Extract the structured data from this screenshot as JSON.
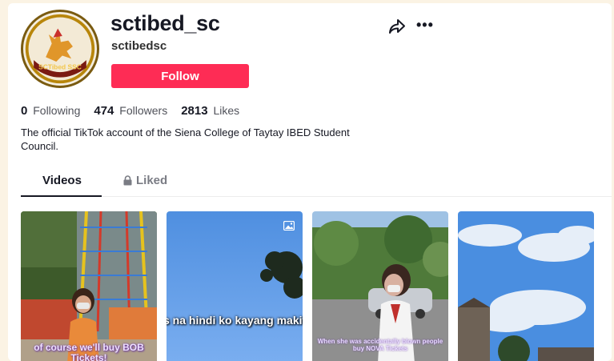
{
  "profile": {
    "username": "sctibed_sc",
    "nickname": "sctibedsc",
    "follow_label": "Follow",
    "bio": "The official TikTok account of the Siena College of Taytay IBED Student Council.",
    "avatar_text": "SCTibed SSC"
  },
  "stats": [
    {
      "value": "0",
      "label": "Following"
    },
    {
      "value": "474",
      "label": "Followers"
    },
    {
      "value": "2813",
      "label": "Likes"
    }
  ],
  "tabs": {
    "videos": "Videos",
    "liked": "Liked"
  },
  "videos": [
    {
      "caption": "of course we'll buy BOB Tickets!"
    },
    {
      "caption": "s na hindi ko kayang makita"
    },
    {
      "caption": "When she was accidentally blown people buy NOVA Tickets"
    },
    {
      "caption": ""
    }
  ],
  "colors": {
    "follow": "#fe2c55",
    "background": "#fbf3e4"
  },
  "icons": [
    "share-icon",
    "more-icon",
    "lock-icon",
    "picture-icon"
  ]
}
